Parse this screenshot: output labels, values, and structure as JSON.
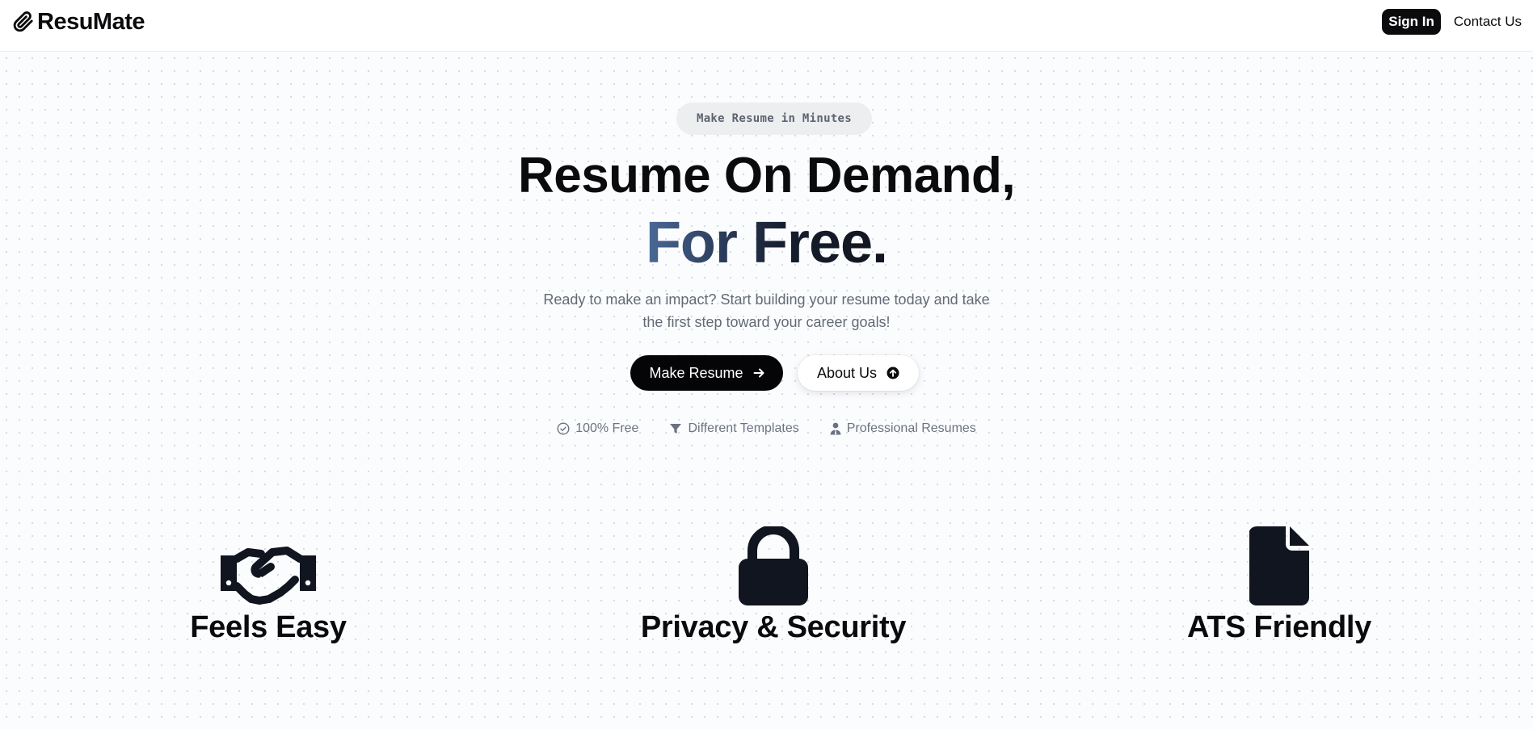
{
  "header": {
    "brand": "ResuMate",
    "sign_in": "Sign In",
    "contact": "Contact Us"
  },
  "hero": {
    "badge": "Make Resume in Minutes",
    "title_line1": "Resume On Demand,",
    "title_line2": "For Free.",
    "subtitle": "Ready to make an impact? Start building your resume today and take the first step toward your career goals!",
    "primary_cta": "Make Resume",
    "secondary_cta": "About Us",
    "features": [
      {
        "label": "100% Free",
        "icon": "check-circle-icon"
      },
      {
        "label": "Different Templates",
        "icon": "filter-icon"
      },
      {
        "label": "Professional Resumes",
        "icon": "user-tie-icon"
      }
    ]
  },
  "cards": [
    {
      "title": "Feels Easy",
      "icon": "handshake-icon"
    },
    {
      "title": "Privacy & Security",
      "icon": "lock-icon"
    },
    {
      "title": "ATS Friendly",
      "icon": "file-icon"
    }
  ],
  "colors": {
    "primary": "#0b0b0d",
    "muted_text": "#636a75",
    "gradient_start": "#4a6a99",
    "gradient_end": "#11151f",
    "icon": "#11151f"
  }
}
